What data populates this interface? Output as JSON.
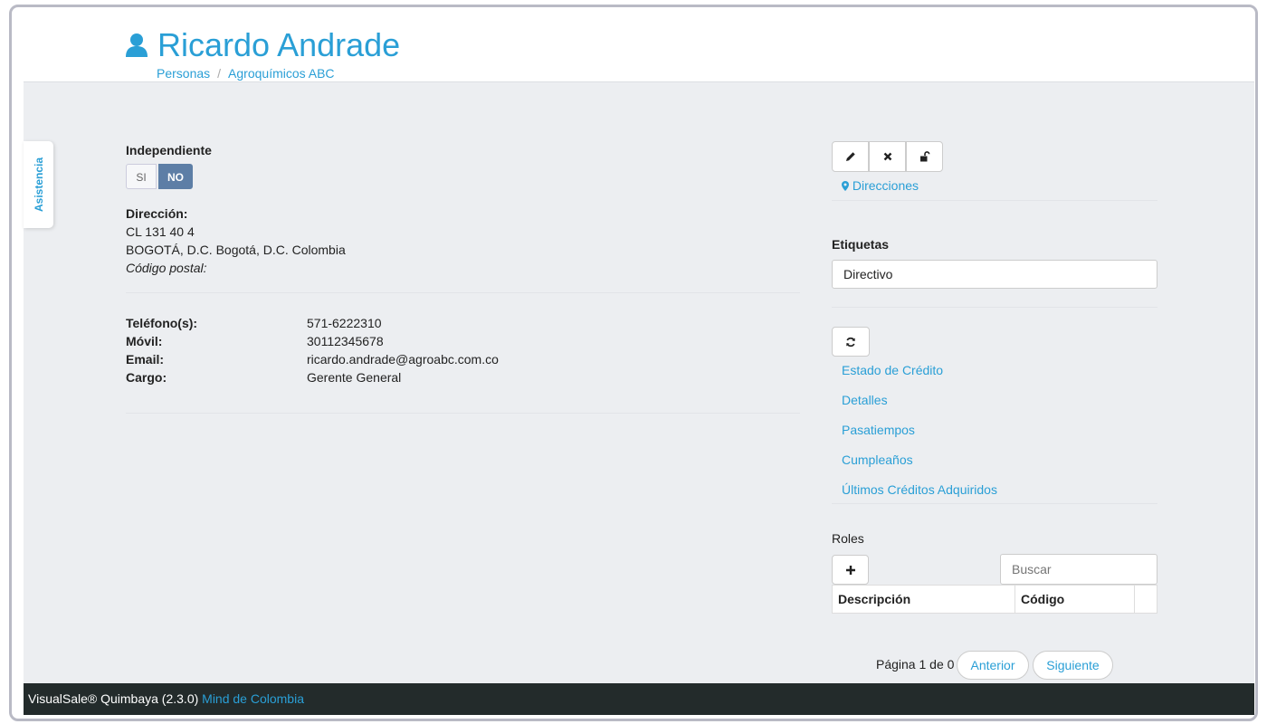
{
  "header": {
    "title": "Ricardo Andrade",
    "breadcrumb": [
      "Personas",
      "Agroquímicos ABC"
    ]
  },
  "side_tab": {
    "label": "Asistencia"
  },
  "left": {
    "independiente_label": "Independiente",
    "toggle": {
      "si": "SI",
      "no": "NO",
      "selected": "NO"
    },
    "direccion_label": "Dirección:",
    "direccion_line1": "CL 131 40 4",
    "direccion_line2": "BOGOTÁ, D.C. Bogotá, D.C. Colombia",
    "codigo_postal_label": "Código postal:",
    "contacts": [
      {
        "label": "Teléfono(s):",
        "value": "571-6222310"
      },
      {
        "label": "Móvil:",
        "value": "30112345678"
      },
      {
        "label": "Email:",
        "value": "ricardo.andrade@agroabc.com.co"
      },
      {
        "label": "Cargo:",
        "value": "Gerente General"
      }
    ]
  },
  "right": {
    "action_icons": [
      "pencil-icon",
      "close-icon",
      "unlock-icon"
    ],
    "direcciones_link": "Direcciones",
    "etiquetas_label": "Etiquetas",
    "etiquetas_value": "Directivo",
    "refresh_icon": "refresh-icon",
    "links": [
      "Estado de Crédito",
      "Detalles",
      "Pasatiempos",
      "Cumpleaños",
      "Últimos Créditos Adquiridos"
    ],
    "roles_label": "Roles",
    "add_icon": "plus-icon",
    "search_placeholder": "Buscar",
    "table_headers": [
      "Descripción",
      "Código"
    ],
    "pagination": {
      "text": "Página 1 de 0",
      "prev": "Anterior",
      "next": "Siguiente"
    }
  },
  "footer": {
    "brand": "VisualSale® Quimbaya (2.3.0)",
    "company": "Mind de Colombia"
  },
  "colors": {
    "accent": "#2a9fd6",
    "toggle_selected": "#5d7ea6",
    "footer_bg": "#232b2b",
    "content_bg": "#eceef1"
  }
}
